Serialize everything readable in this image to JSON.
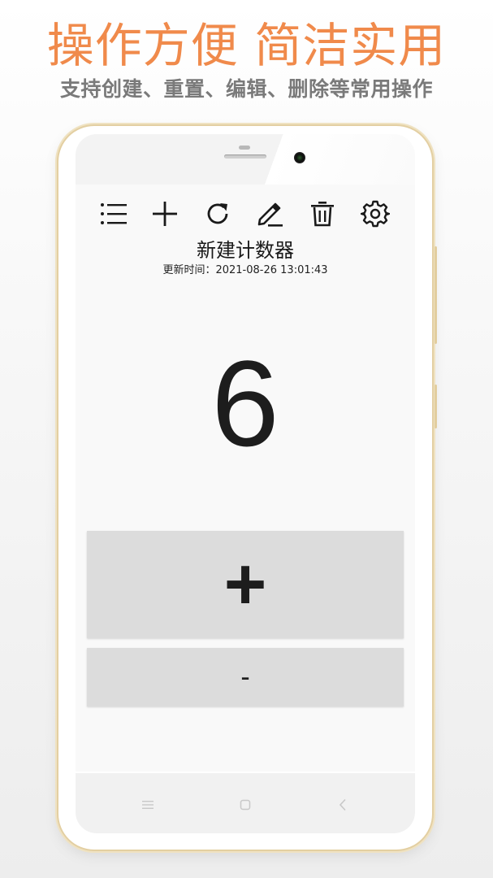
{
  "promo": {
    "title": "操作方便 简洁实用",
    "subtitle": "支持创建、重置、编辑、删除等常用操作"
  },
  "toolbar": {
    "icons": [
      "list-icon",
      "add-icon",
      "refresh-icon",
      "edit-icon",
      "trash-icon",
      "settings-icon"
    ]
  },
  "counter": {
    "title": "新建计数器",
    "updated_label": "更新时间：",
    "updated_time": "2021-08-26 13:01:43",
    "value": "6"
  },
  "buttons": {
    "increment_label": "+",
    "decrement_label": "-"
  },
  "navbar": {
    "icons": [
      "menu-icon",
      "home-icon",
      "back-icon"
    ]
  },
  "colors": {
    "accent": "#f08a4b",
    "subtitle": "#7a7a7a",
    "button_bg": "#dcdcdc",
    "phone_trim": "#e3cfa2"
  }
}
